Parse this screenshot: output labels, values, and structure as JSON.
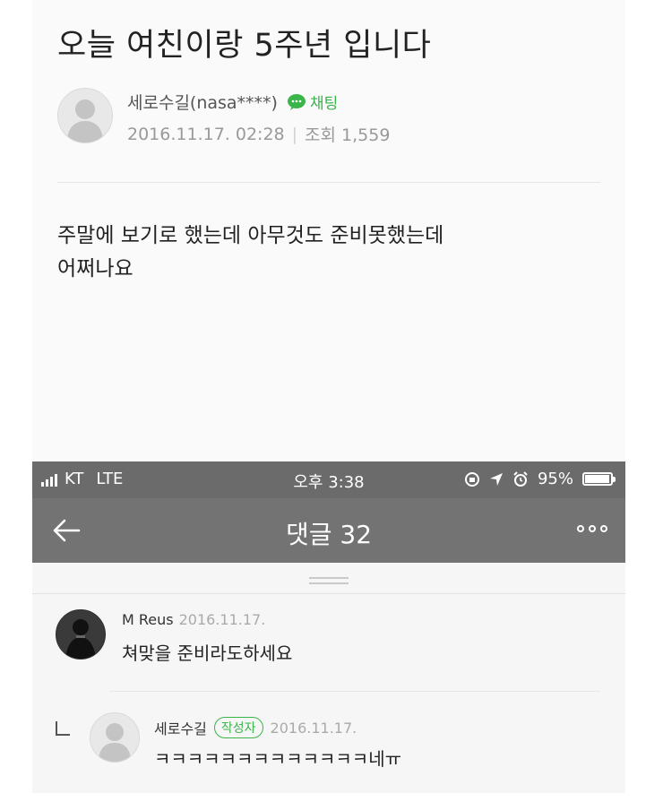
{
  "post": {
    "title": "오늘 여친이랑 5주년 입니다",
    "author": "세로수길(nasa****)",
    "chat_label": "채팅",
    "date": "2016.11.17. 02:28",
    "views_label": "조회 1,559",
    "body": "주말에 보기로 했는데 아무것도 준비못했는데\n어쩌나요"
  },
  "statusbar": {
    "carrier": "KT",
    "network": "LTE",
    "time": "오후 3:38",
    "battery_text": "95%",
    "battery_level": 0.95
  },
  "navbar": {
    "title": "댓글 32"
  },
  "comments": [
    {
      "name": "M Reus",
      "date": "2016.11.17.",
      "text": "쳐맞을 준비라도하세요"
    },
    {
      "name": "세로수길",
      "badge": "작성자",
      "date": "2016.11.17.",
      "text": "ㅋㅋㅋㅋㅋㅋㅋㅋㅋㅋㅋㅋㅋ네ㅠ"
    }
  ],
  "icons": [
    "avatar-placeholder-icon",
    "chat-bubble-icon",
    "signal-icon",
    "lock-rotation-icon",
    "location-icon",
    "alarm-icon",
    "battery-icon",
    "back-arrow-icon",
    "more-icon",
    "reply-icon"
  ],
  "colors": {
    "accent_green": "#39b54a",
    "header_gray": "#737373",
    "status_gray": "#6b6b6b"
  }
}
